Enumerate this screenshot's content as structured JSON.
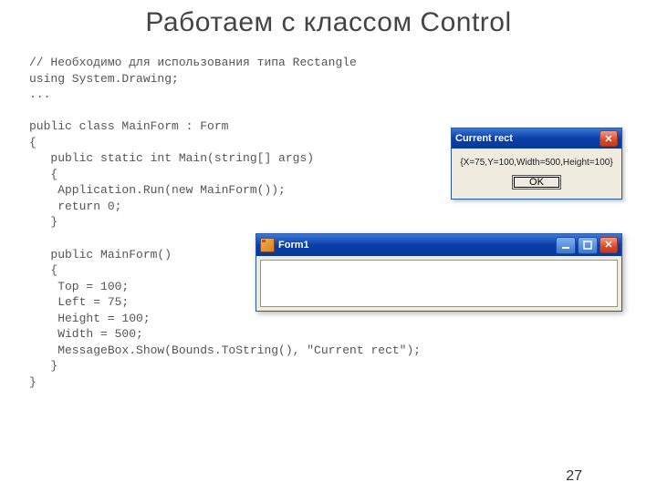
{
  "title": "Работаем с классом Control",
  "code": "// Необходимо для использования типа Rectangle\nusing System.Drawing;\n...\n\npublic class MainForm : Form\n{\n   public static int Main(string[] args)\n   {\n    Application.Run(new MainForm());\n    return 0;\n   }\n\n   public MainForm()\n   {\n    Top = 100;\n    Left = 75;\n    Height = 100;\n    Width = 500;\n    MessageBox.Show(Bounds.ToString(), \"Current rect\");\n   }\n}",
  "msgbox": {
    "title": "Current rect",
    "text": "{X=75,Y=100,Width=500,Height=100}",
    "ok": "OK"
  },
  "form": {
    "title": "Form1"
  },
  "page_number": "27"
}
